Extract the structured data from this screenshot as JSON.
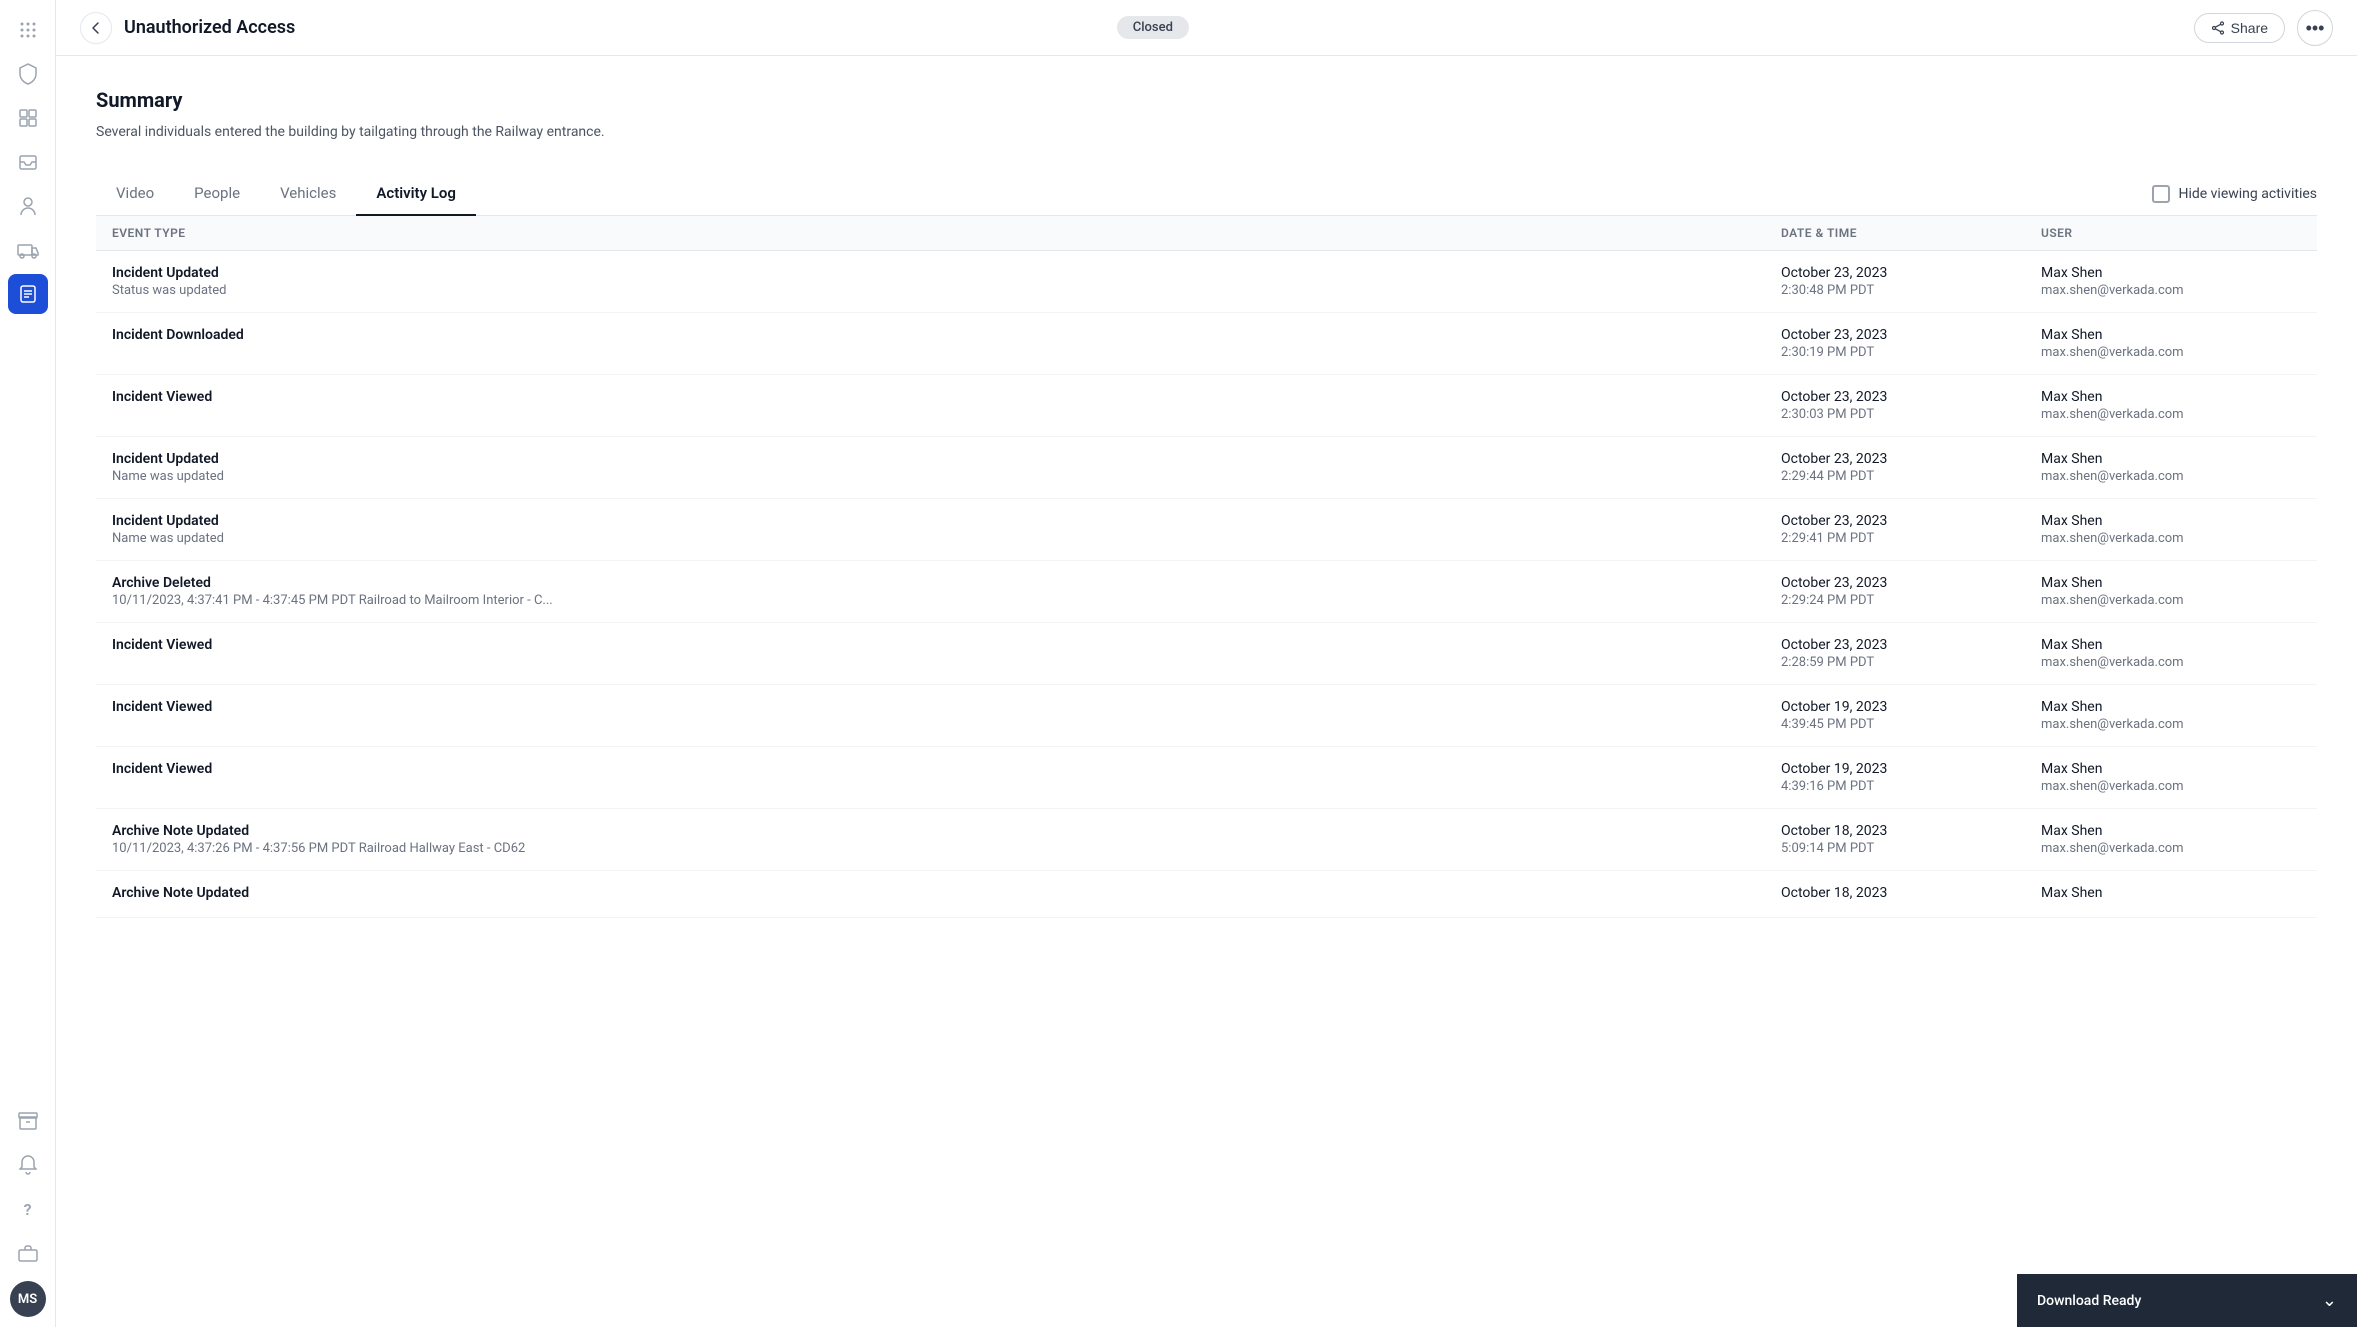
{
  "topbar": {
    "back_label": "←",
    "title": "Unauthorized Access",
    "status": "Closed",
    "share_label": "Share",
    "more_label": "•••"
  },
  "summary": {
    "title": "Summary",
    "description": "Several individuals entered the building by tailgating through the Railway entrance."
  },
  "tabs": [
    {
      "id": "video",
      "label": "Video",
      "active": false
    },
    {
      "id": "people",
      "label": "People",
      "active": false
    },
    {
      "id": "vehicles",
      "label": "Vehicles",
      "active": false
    },
    {
      "id": "activity-log",
      "label": "Activity Log",
      "active": true
    }
  ],
  "hide_viewing": {
    "label": "Hide viewing activities"
  },
  "table": {
    "headers": [
      "Event Type",
      "Date & Time",
      "User"
    ],
    "rows": [
      {
        "event_type": "Incident Updated",
        "event_detail": "Status was updated",
        "date": "October 23, 2023",
        "time": "2:30:48 PM PDT",
        "user_name": "Max Shen",
        "user_email": "max.shen@verkada.com"
      },
      {
        "event_type": "Incident Downloaded",
        "event_detail": "",
        "date": "October 23, 2023",
        "time": "2:30:19 PM PDT",
        "user_name": "Max Shen",
        "user_email": "max.shen@verkada.com"
      },
      {
        "event_type": "Incident Viewed",
        "event_detail": "",
        "date": "October 23, 2023",
        "time": "2:30:03 PM PDT",
        "user_name": "Max Shen",
        "user_email": "max.shen@verkada.com"
      },
      {
        "event_type": "Incident Updated",
        "event_detail": "Name was updated",
        "date": "October 23, 2023",
        "time": "2:29:44 PM PDT",
        "user_name": "Max Shen",
        "user_email": "max.shen@verkada.com"
      },
      {
        "event_type": "Incident Updated",
        "event_detail": "Name was updated",
        "date": "October 23, 2023",
        "time": "2:29:41 PM PDT",
        "user_name": "Max Shen",
        "user_email": "max.shen@verkada.com"
      },
      {
        "event_type": "Archive Deleted",
        "event_detail": "10/11/2023, 4:37:41 PM - 4:37:45 PM PDT Railroad to Mailroom Interior - C...",
        "date": "October 23, 2023",
        "time": "2:29:24 PM PDT",
        "user_name": "Max Shen",
        "user_email": "max.shen@verkada.com"
      },
      {
        "event_type": "Incident Viewed",
        "event_detail": "",
        "date": "October 23, 2023",
        "time": "2:28:59 PM PDT",
        "user_name": "Max Shen",
        "user_email": "max.shen@verkada.com"
      },
      {
        "event_type": "Incident Viewed",
        "event_detail": "",
        "date": "October 19, 2023",
        "time": "4:39:45 PM PDT",
        "user_name": "Max Shen",
        "user_email": "max.shen@verkada.com"
      },
      {
        "event_type": "Incident Viewed",
        "event_detail": "",
        "date": "October 19, 2023",
        "time": "4:39:16 PM PDT",
        "user_name": "Max Shen",
        "user_email": "max.shen@verkada.com"
      },
      {
        "event_type": "Archive Note Updated",
        "event_detail": "10/11/2023, 4:37:26 PM - 4:37:56 PM PDT Railroad Hallway East - CD62",
        "date": "October 18, 2023",
        "time": "5:09:14 PM PDT",
        "user_name": "Max Shen",
        "user_email": "max.shen@verkada.com"
      },
      {
        "event_type": "Archive Note Updated",
        "event_detail": "",
        "date": "October 18, 2023",
        "time": "",
        "user_name": "Max Shen",
        "user_email": ""
      }
    ]
  },
  "download_ready": {
    "label": "Download Ready"
  },
  "sidebar": {
    "icons": [
      {
        "name": "grid-icon",
        "symbol": "⊞",
        "active": false
      },
      {
        "name": "dashboard-icon",
        "symbol": "▦",
        "active": false
      },
      {
        "name": "inbox-icon",
        "symbol": "☰",
        "active": false
      },
      {
        "name": "person-pin-icon",
        "symbol": "⊕",
        "active": false
      },
      {
        "name": "truck-icon",
        "symbol": "🚐",
        "active": false
      },
      {
        "name": "activity-icon",
        "symbol": "📋",
        "active": true
      },
      {
        "name": "archive-icon",
        "symbol": "🗂",
        "active": false
      },
      {
        "name": "bell-icon",
        "symbol": "🔔",
        "active": false
      },
      {
        "name": "help-icon",
        "symbol": "?",
        "active": false
      },
      {
        "name": "briefcase-icon",
        "symbol": "💼",
        "active": false
      }
    ]
  }
}
